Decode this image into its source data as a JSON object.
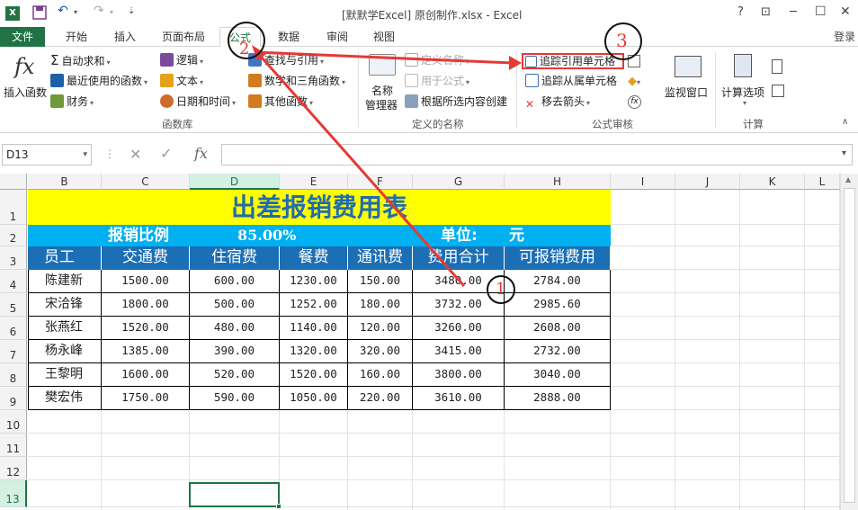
{
  "title": "[默默学Excel] 原创制作.xlsx - Excel",
  "window_controls": {
    "help": "?",
    "ribbon": "⊡",
    "minimize": "─",
    "maximize": "☐",
    "close": "✕"
  },
  "login": "登录",
  "tabs": [
    "文件",
    "开始",
    "插入",
    "页面布局",
    "公式",
    "数据",
    "审阅",
    "视图"
  ],
  "ribbon": {
    "insert_function": "插入函数",
    "autosum": "自动求和",
    "recent": "最近使用的函数",
    "financial": "财务",
    "logical": "逻辑",
    "text": "文本",
    "datetime": "日期和时间",
    "lookup": "查找与引用",
    "math": "数学和三角函数",
    "more": "其他函数",
    "name_manager": "名称\n管理器",
    "name_manager_1": "名称",
    "name_manager_2": "管理器",
    "define_name": "定义名称",
    "use_in_formula": "用于公式",
    "create_from_selection": "根据所选内容创建",
    "trace_precedents": "追踪引用单元格",
    "trace_dependents": "追踪从属单元格",
    "remove_arrows": "移去箭头",
    "watch_window": "监视窗口",
    "calc_options": "计算选项",
    "group_function_library": "函数库",
    "group_defined_names": "定义的名称",
    "group_formula_auditing": "公式审核",
    "group_calculation": "计算"
  },
  "formula_bar": {
    "name_box": "D13",
    "fx": "fx",
    "value": ""
  },
  "columns": [
    "B",
    "C",
    "D",
    "E",
    "F",
    "G",
    "H",
    "I",
    "J",
    "K",
    "L"
  ],
  "rows": [
    "1",
    "2",
    "3",
    "4",
    "5",
    "6",
    "7",
    "8",
    "9",
    "10",
    "11",
    "12",
    "13"
  ],
  "sheet": {
    "title": "出差报销费用表",
    "ratio_label": "报销比例",
    "ratio_value": "85.00%",
    "unit_label": "单位:",
    "unit_value": "元",
    "headers": [
      "员工",
      "交通费",
      "住宿费",
      "餐费",
      "通讯费",
      "费用合计",
      "可报销费用"
    ],
    "data": [
      [
        "陈建新",
        "1500.00",
        "600.00",
        "1230.00",
        "150.00",
        "3480.00",
        "2784.00"
      ],
      [
        "宋洽锋",
        "1800.00",
        "500.00",
        "1252.00",
        "180.00",
        "3732.00",
        "2985.60"
      ],
      [
        "张燕红",
        "1520.00",
        "480.00",
        "1140.00",
        "120.00",
        "3260.00",
        "2608.00"
      ],
      [
        "杨永峰",
        "1385.00",
        "390.00",
        "1320.00",
        "320.00",
        "3415.00",
        "2732.00"
      ],
      [
        "王黎明",
        "1600.00",
        "520.00",
        "1520.00",
        "160.00",
        "3800.00",
        "3040.00"
      ],
      [
        "樊宏伟",
        "1750.00",
        "590.00",
        "1050.00",
        "220.00",
        "3610.00",
        "2888.00"
      ]
    ]
  },
  "annotations": {
    "one": "1",
    "two": "2",
    "three": "3"
  },
  "colors": {
    "excel_green": "#217346",
    "title_bg": "#ffff00",
    "title_text": "#1f6cb0",
    "row2_bg": "#00b0f0",
    "header_bg": "#1c6fb5",
    "arrow": "#e53935"
  }
}
